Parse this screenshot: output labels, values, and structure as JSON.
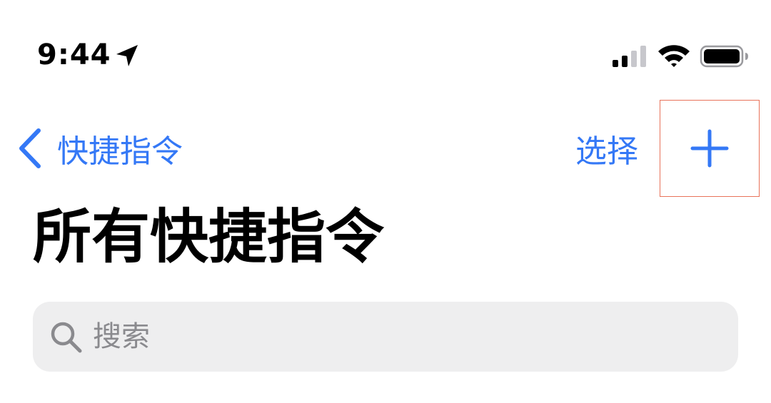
{
  "status_bar": {
    "time": "9:44",
    "icons": [
      "location-arrow-icon",
      "cellular-signal-icon",
      "wifi-icon",
      "battery-icon"
    ]
  },
  "nav": {
    "back_label": "快捷指令",
    "select_label": "选择",
    "add_icon": "plus-icon"
  },
  "title": "所有快捷指令",
  "search": {
    "placeholder": "搜索",
    "value": ""
  },
  "colors": {
    "accent": "#3478f6",
    "search_bg": "#eeeeef",
    "placeholder": "#8a8a8e",
    "highlight_border": "#e8735a"
  }
}
